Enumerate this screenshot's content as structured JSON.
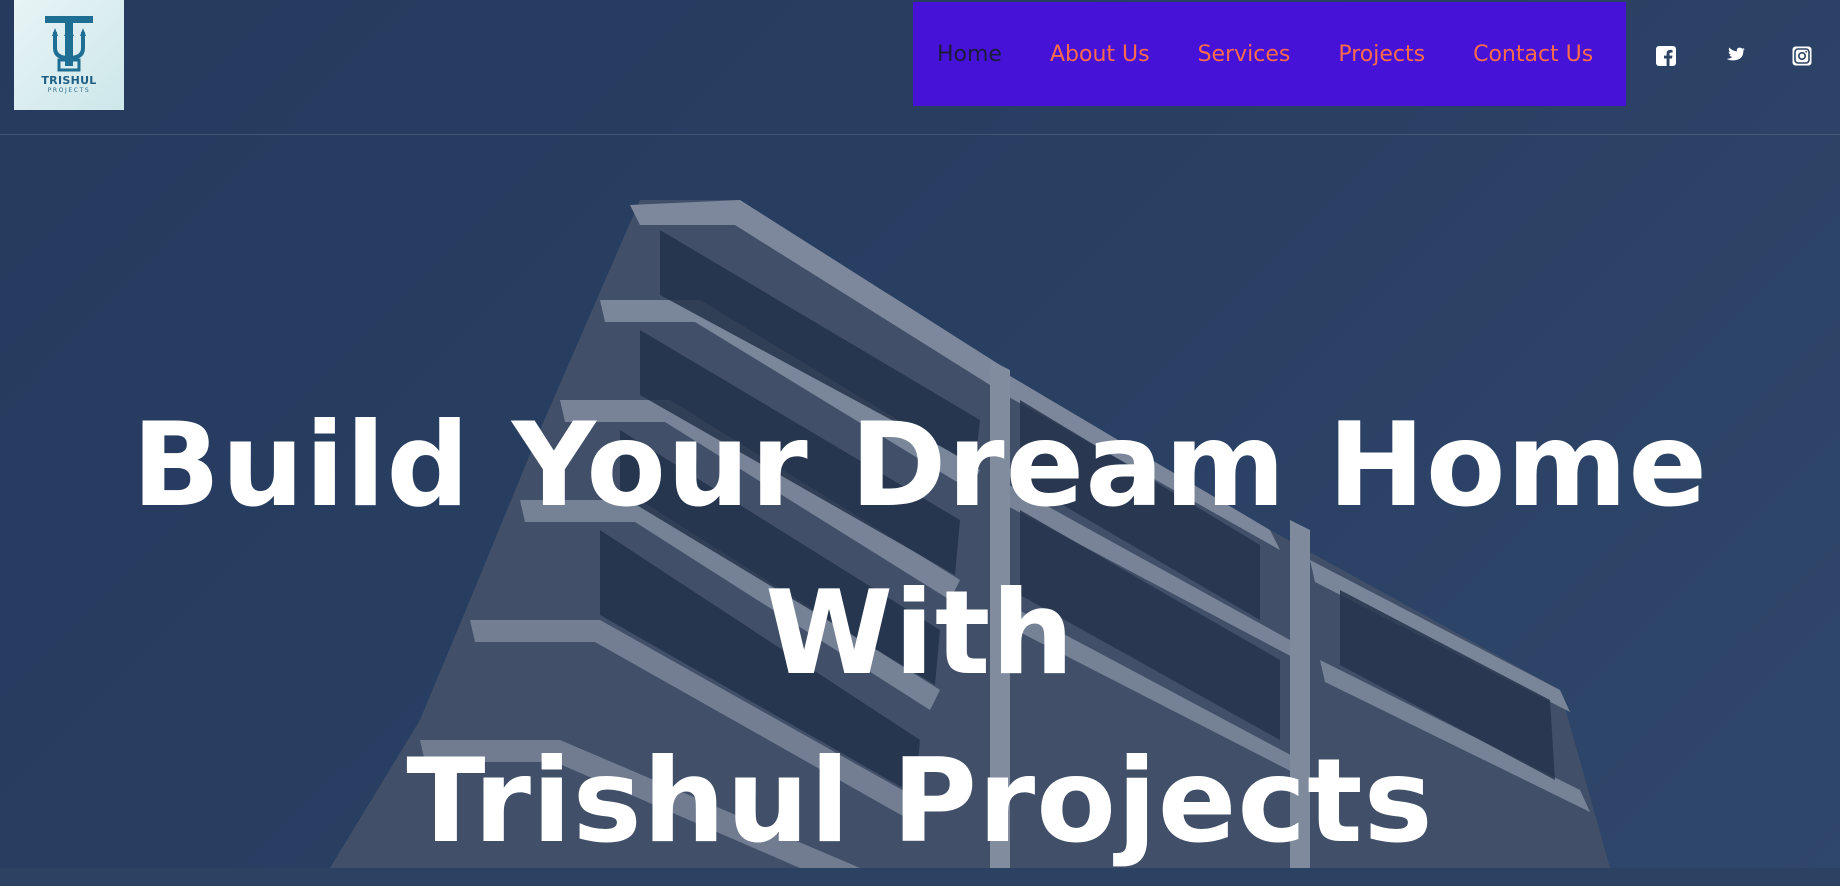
{
  "logo": {
    "name": "TRISHUL",
    "tagline": "PROJECTS",
    "icon": "trident-icon"
  },
  "nav": {
    "items": [
      {
        "label": "Home",
        "active": true
      },
      {
        "label": "About Us",
        "active": false
      },
      {
        "label": "Services",
        "active": false
      },
      {
        "label": "Projects",
        "active": false
      },
      {
        "label": "Contact Us",
        "active": false
      }
    ],
    "background": "#4612d8",
    "link_color": "#ff6b4a",
    "active_color": "#1b1b3a"
  },
  "social": [
    {
      "icon": "facebook-icon"
    },
    {
      "icon": "twitter-icon"
    },
    {
      "icon": "instagram-icon"
    }
  ],
  "hero": {
    "title_lines": [
      "Build Your Dream Home",
      "With",
      "Trishul Projects"
    ],
    "background_image": "modern-apartment-building-photo",
    "overlay_color": "#21355a"
  }
}
